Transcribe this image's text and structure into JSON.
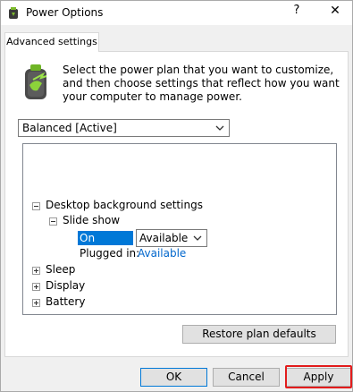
{
  "window": {
    "title": "Power Options",
    "help_label": "?",
    "close_label": "✕"
  },
  "tabs": [
    {
      "label": "Advanced settings"
    }
  ],
  "description": "Select the power plan that you want to customize, and then choose settings that reflect how you want your computer to manage power.",
  "plan_select": {
    "value": "Balanced [Active]"
  },
  "tree": {
    "items": [
      {
        "label": "Desktop background settings",
        "expanded": true
      },
      {
        "label": "Slide show",
        "expanded": true
      },
      {
        "label": "Sleep",
        "expanded": false
      },
      {
        "label": "Display",
        "expanded": false
      },
      {
        "label": "Battery",
        "expanded": false
      }
    ],
    "on_battery": {
      "label": "On battery:",
      "value": "Available"
    },
    "plugged_in": {
      "label": "Plugged in:",
      "value": "Available"
    }
  },
  "buttons": {
    "restore": "Restore plan defaults",
    "ok": "OK",
    "cancel": "Cancel",
    "apply": "Apply"
  },
  "colors": {
    "selection": "#0078d7",
    "link": "#0066cc",
    "highlight": "#e21c1c"
  }
}
